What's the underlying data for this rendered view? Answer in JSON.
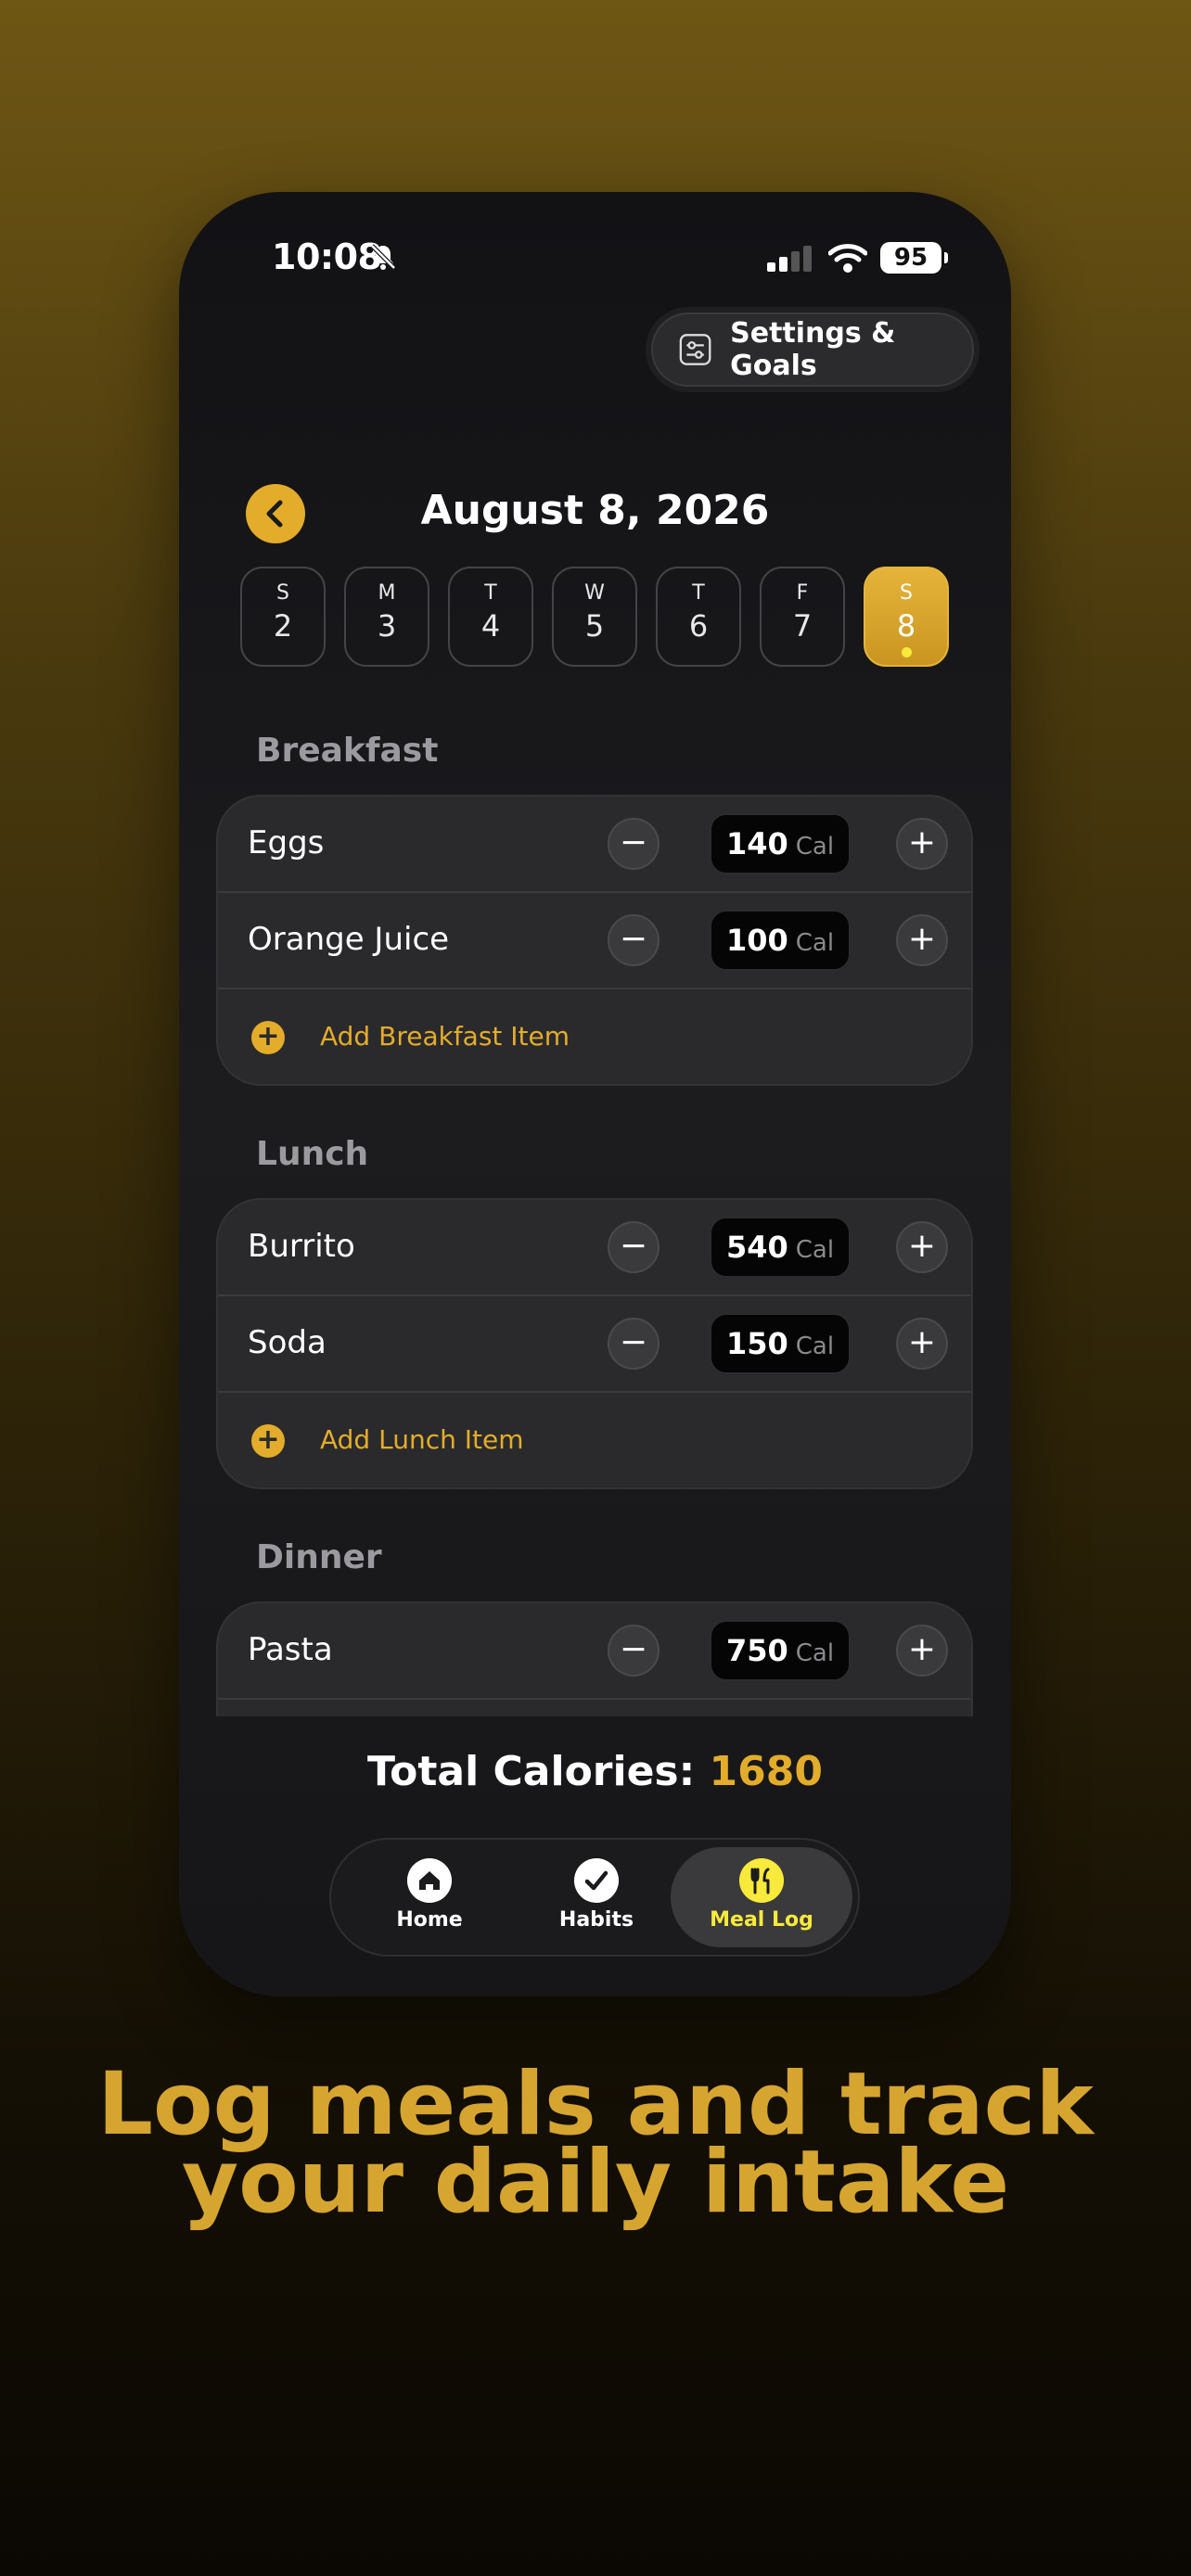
{
  "status": {
    "time": "10:08",
    "battery": "95"
  },
  "header": {
    "settings_label": "Settings & Goals",
    "date_title": "August 8, 2026"
  },
  "days": [
    {
      "letter": "S",
      "num": "2"
    },
    {
      "letter": "M",
      "num": "3"
    },
    {
      "letter": "T",
      "num": "4"
    },
    {
      "letter": "W",
      "num": "5"
    },
    {
      "letter": "T",
      "num": "6"
    },
    {
      "letter": "F",
      "num": "7"
    },
    {
      "letter": "S",
      "num": "8",
      "selected": true
    }
  ],
  "meals": {
    "breakfast": {
      "title": "Breakfast",
      "items": [
        {
          "name": "Eggs",
          "cal": "140",
          "unit": "Cal"
        },
        {
          "name": "Orange Juice",
          "cal": "100",
          "unit": "Cal"
        }
      ],
      "add_label": "Add Breakfast Item"
    },
    "lunch": {
      "title": "Lunch",
      "items": [
        {
          "name": "Burrito",
          "cal": "540",
          "unit": "Cal"
        },
        {
          "name": "Soda",
          "cal": "150",
          "unit": "Cal"
        }
      ],
      "add_label": "Add Lunch Item"
    },
    "dinner": {
      "title": "Dinner",
      "items": [
        {
          "name": "Pasta",
          "cal": "750",
          "unit": "Cal"
        }
      ]
    }
  },
  "total": {
    "label": "Total Calories:",
    "value": "1680"
  },
  "tabs": [
    {
      "label": "Home",
      "icon": "home-icon"
    },
    {
      "label": "Habits",
      "icon": "check-icon"
    },
    {
      "label": "Meal Log",
      "icon": "utensils-icon",
      "active": true
    }
  ],
  "caption": {
    "line1": "Log meals and track",
    "line2": "your daily intake"
  },
  "colors": {
    "accent": "#e3ac2b",
    "active_tab": "#f7ea3a"
  }
}
